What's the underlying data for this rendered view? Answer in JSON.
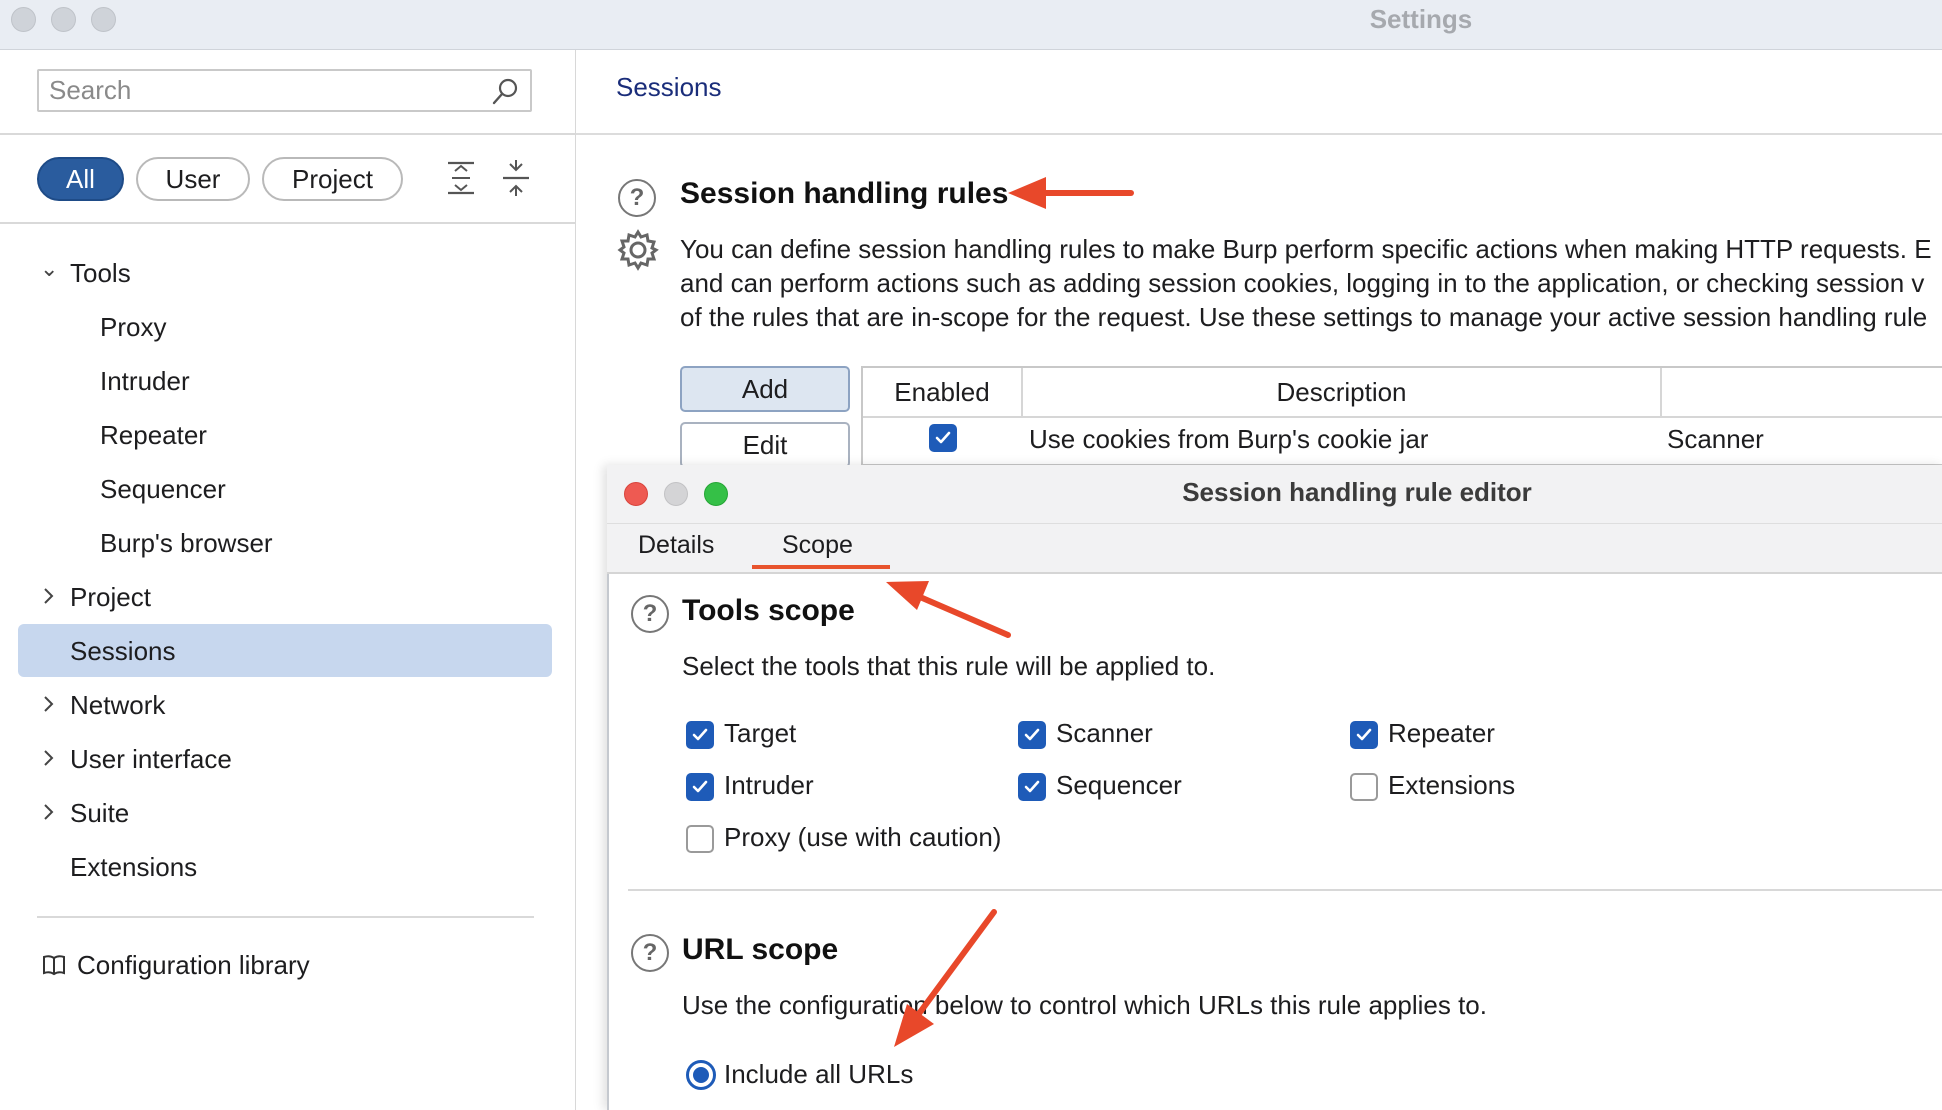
{
  "window": {
    "title": "Settings"
  },
  "sidebar": {
    "search_placeholder": "Search",
    "filters": [
      "All",
      "User",
      "Project"
    ],
    "tree": {
      "tools": "Tools",
      "tools_children": [
        "Proxy",
        "Intruder",
        "Repeater",
        "Sequencer",
        "Burp's browser"
      ],
      "project": "Project",
      "sessions": "Sessions",
      "network": "Network",
      "user_interface": "User interface",
      "suite": "Suite",
      "extensions": "Extensions"
    },
    "config_library": "Configuration library"
  },
  "main": {
    "breadcrumb": "Sessions",
    "section_title": "Session handling rules",
    "description_lines": [
      "You can define session handling rules to make Burp perform specific actions when making HTTP requests. E",
      "and can perform actions such as adding session cookies, logging in to the application, or checking session v",
      "of the rules that are in-scope for the request. Use these settings to manage your active session handling rule"
    ],
    "buttons": {
      "add": "Add",
      "edit": "Edit"
    },
    "table": {
      "headers": [
        "Enabled",
        "Description"
      ],
      "rows": [
        {
          "enabled": true,
          "description": "Use cookies from Burp's cookie jar",
          "tools": "Scanner"
        }
      ]
    }
  },
  "dialog": {
    "title": "Session handling rule editor",
    "tabs": [
      "Details",
      "Scope"
    ],
    "active_tab": "Scope",
    "tools_scope": {
      "title": "Tools scope",
      "subtitle": "Select the tools that this rule will be applied to.",
      "tools": [
        {
          "label": "Target",
          "checked": true
        },
        {
          "label": "Scanner",
          "checked": true
        },
        {
          "label": "Repeater",
          "checked": true
        },
        {
          "label": "Intruder",
          "checked": true
        },
        {
          "label": "Sequencer",
          "checked": true
        },
        {
          "label": "Extensions",
          "checked": false
        },
        {
          "label": "Proxy (use with caution)",
          "checked": false
        }
      ]
    },
    "url_scope": {
      "title": "URL scope",
      "subtitle": "Use the configuration below to control which URLs this rule applies to.",
      "options": [
        {
          "label": "Include all URLs",
          "selected": true
        }
      ]
    }
  },
  "colors": {
    "accent": "#1e5bb8",
    "selection": "#c7d7ee",
    "annotation": "#e8482a",
    "link": "#1a2d7a"
  }
}
